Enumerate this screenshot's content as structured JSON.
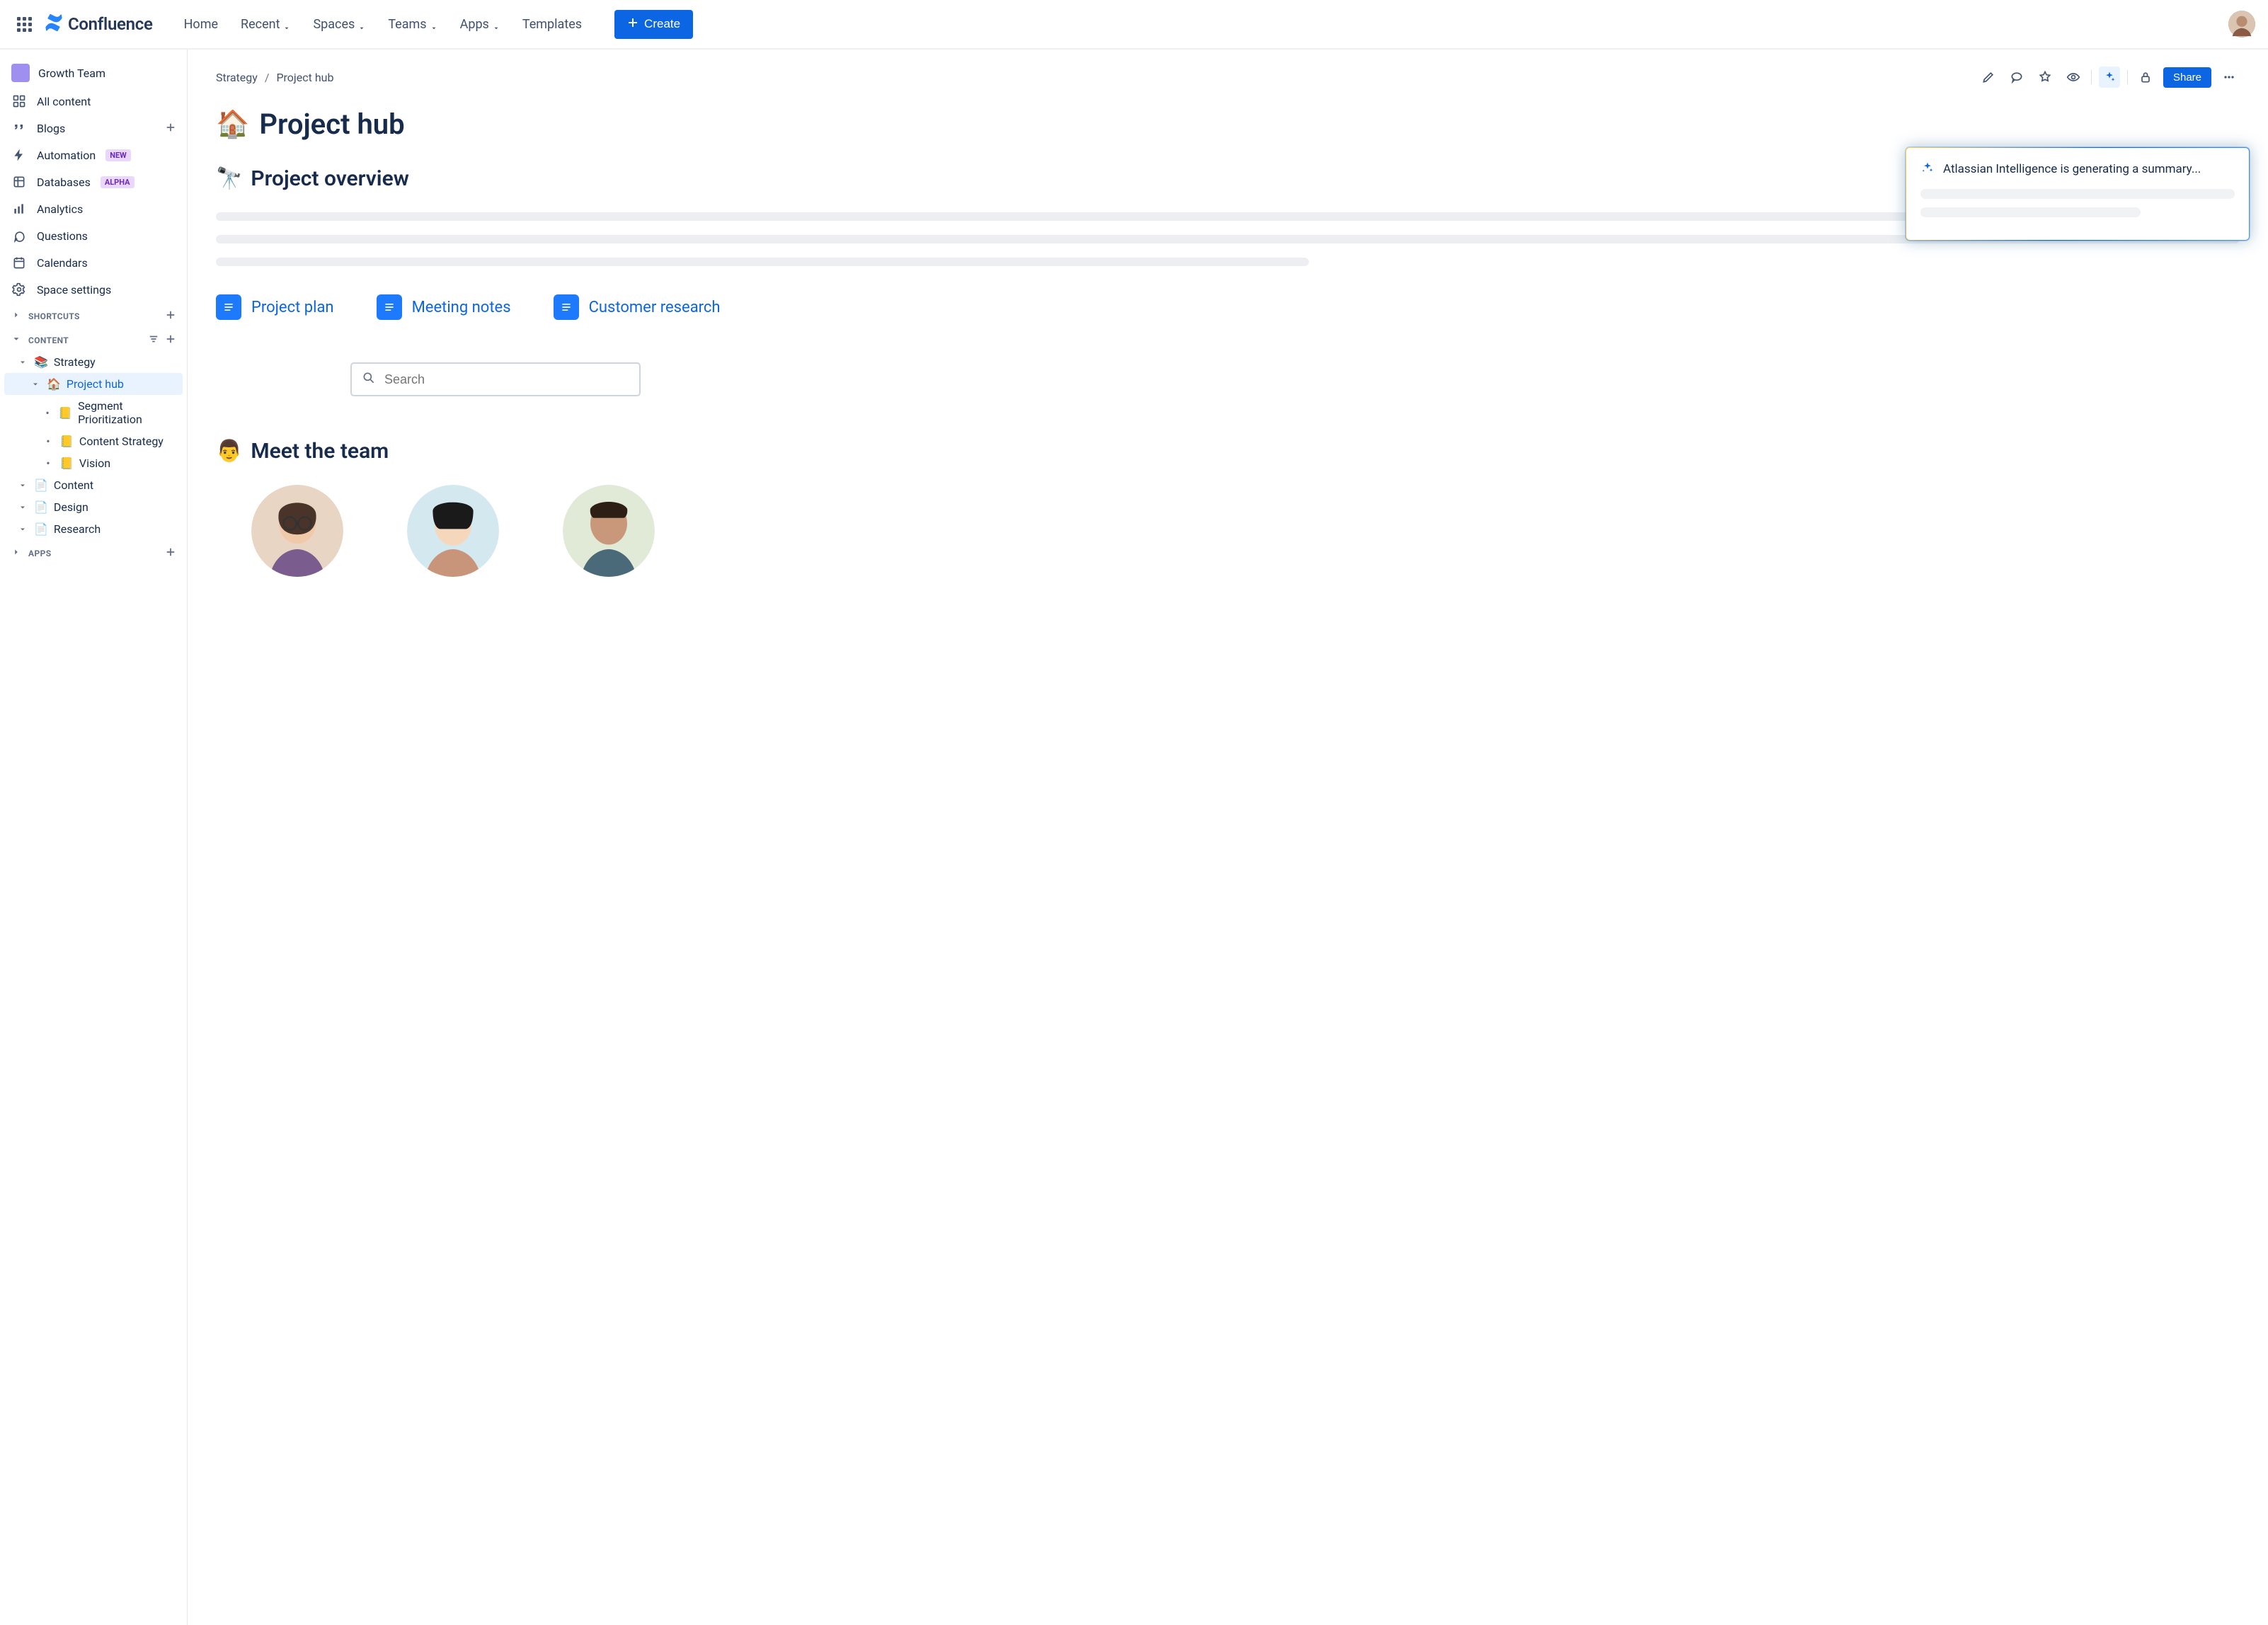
{
  "brand": {
    "name": "Confluence"
  },
  "nav": {
    "home": "Home",
    "recent": "Recent",
    "spaces": "Spaces",
    "teams": "Teams",
    "apps": "Apps",
    "templates": "Templates",
    "create": "Create"
  },
  "sidebar": {
    "space_name": "Growth Team",
    "items": {
      "all_content": "All content",
      "blogs": "Blogs",
      "automation": "Automation",
      "automation_badge": "NEW",
      "databases": "Databases",
      "databases_badge": "ALPHA",
      "analytics": "Analytics",
      "questions": "Questions",
      "calendars": "Calendars",
      "space_settings": "Space settings"
    },
    "sections": {
      "shortcuts": "SHORTCUTS",
      "content": "CONTENT",
      "apps": "APPS"
    },
    "tree": {
      "strategy": "Strategy",
      "project_hub": "Project hub",
      "segment": "Segment Prioritization",
      "content_strategy": "Content Strategy",
      "vision": "Vision",
      "content": "Content",
      "design": "Design",
      "research": "Research"
    }
  },
  "breadcrumb": {
    "parent": "Strategy",
    "current": "Project hub"
  },
  "page": {
    "title": "Project hub",
    "title_emoji": "🏠",
    "overview_heading": "Project overview",
    "overview_emoji": "🔭",
    "meet_heading": "Meet the team",
    "meet_emoji": "👨"
  },
  "doclinks": {
    "plan": "Project plan",
    "notes": "Meeting notes",
    "research": "Customer research"
  },
  "search": {
    "placeholder": "Search"
  },
  "ai": {
    "message": "Atlassian Intelligence is generating a summary..."
  },
  "actions": {
    "share": "Share"
  }
}
